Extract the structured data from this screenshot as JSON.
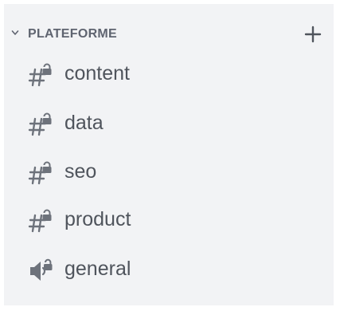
{
  "category": {
    "label": "PLATEFORME",
    "collapse_icon": "chevron-down-icon",
    "add_icon": "plus-icon"
  },
  "channels": [
    {
      "name": "content",
      "icon": "locked-text-channel-icon"
    },
    {
      "name": "data",
      "icon": "locked-text-channel-icon"
    },
    {
      "name": "seo",
      "icon": "locked-text-channel-icon"
    },
    {
      "name": "product",
      "icon": "locked-text-channel-icon"
    },
    {
      "name": "general",
      "icon": "locked-voice-channel-icon"
    }
  ],
  "colors": {
    "background": "#f2f3f5",
    "text": "#4f545c",
    "category_text": "#5f6470",
    "icon": "#6d727b"
  }
}
